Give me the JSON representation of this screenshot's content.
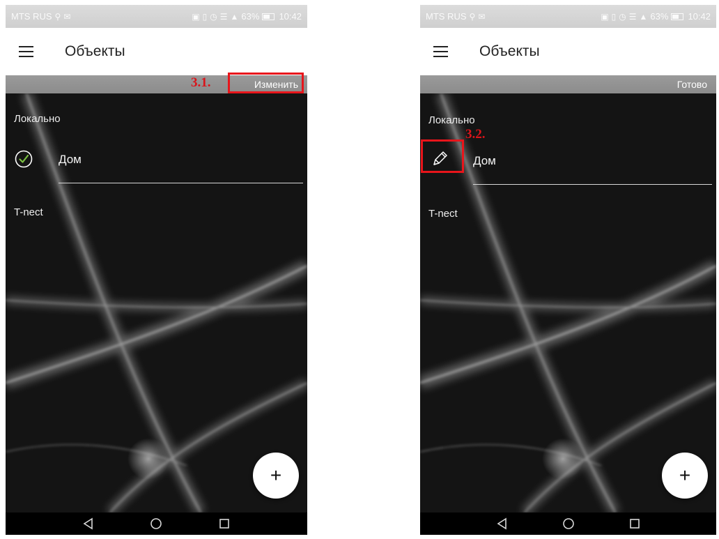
{
  "status": {
    "carrier": "MTS RUS",
    "signal_percent": "63%",
    "time": "10:42"
  },
  "app": {
    "title": "Объекты"
  },
  "left_screen": {
    "strip_button": "Изменить",
    "section_local": "Локально",
    "item_name": "Дом",
    "section_tnect": "T-nect",
    "fab_label": "+",
    "annotation": "3.1."
  },
  "right_screen": {
    "strip_button": "Готово",
    "section_local": "Локально",
    "item_name": "Дом",
    "section_tnect": "T-nect",
    "fab_label": "+",
    "annotation": "3.2."
  },
  "icons": {
    "menu": "hamburger-icon",
    "check": "check-circle-icon",
    "edit": "pencil-icon",
    "back": "back-triangle-icon",
    "home": "home-circle-icon",
    "recents": "recents-square-icon"
  },
  "colors": {
    "annotation_red": "#e8151b",
    "check_green": "#7cc242",
    "strip_gray": "#939393"
  }
}
